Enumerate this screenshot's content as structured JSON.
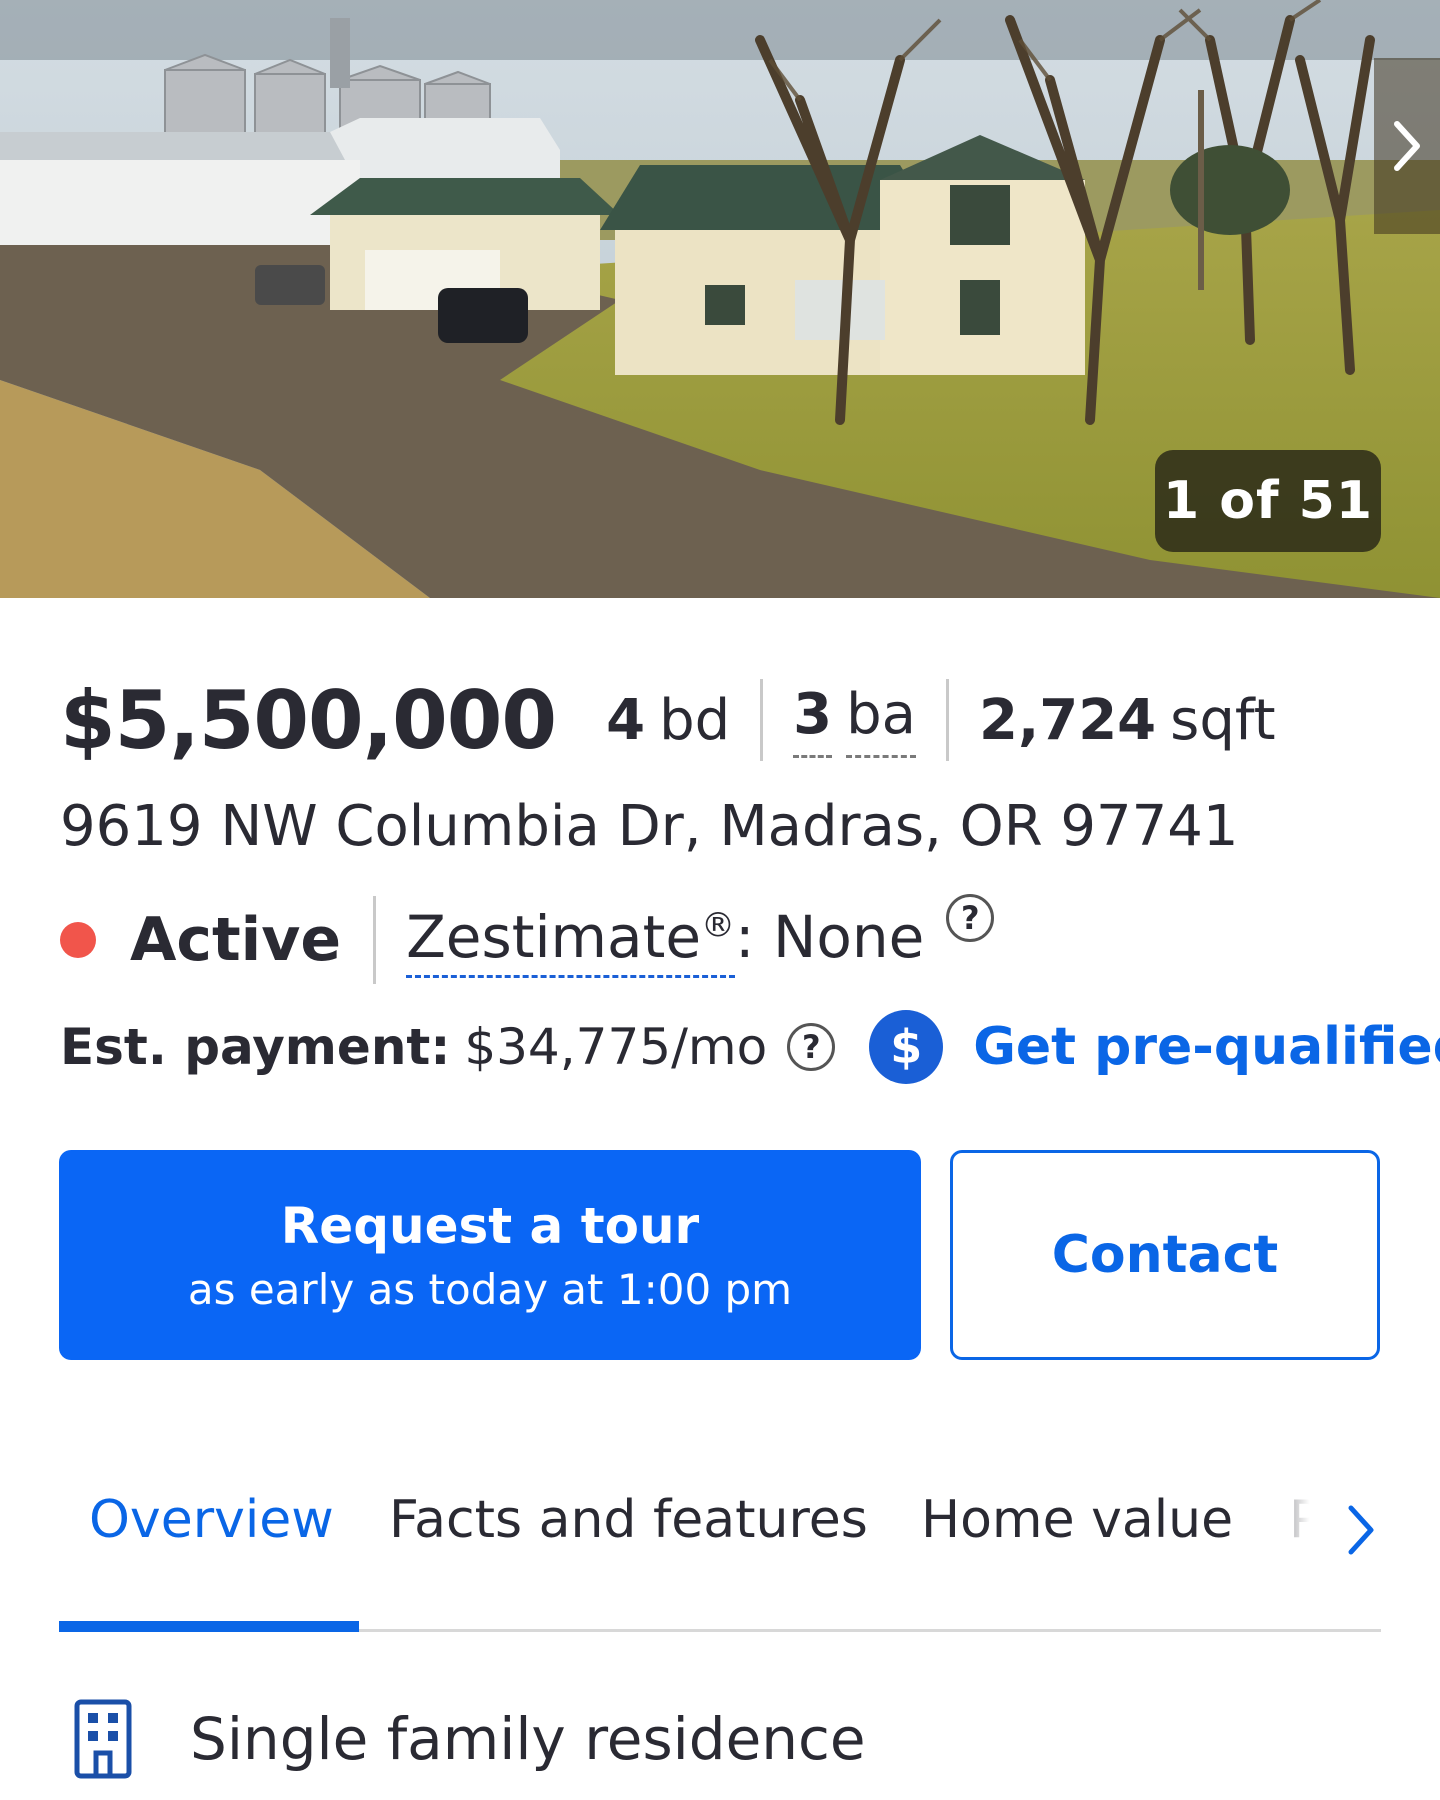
{
  "gallery": {
    "counter": "1 of 51",
    "next_icon": "chevron-right-icon"
  },
  "listing": {
    "price": "$5,500,000",
    "beds_value": "4",
    "beds_unit": "bd",
    "baths_value": "3",
    "baths_unit": "ba",
    "sqft_value": "2,724",
    "sqft_unit": "sqft",
    "address": "9619 NW Columbia Dr, Madras, OR 97741",
    "status": "Active",
    "status_color": "#f1554b",
    "zestimate_label": "Zestimate",
    "zestimate_mark": "®",
    "zestimate_value": ": None",
    "help_glyph": "?"
  },
  "payment": {
    "label": "Est. payment:",
    "value": "$34,775/mo",
    "help_glyph": "?",
    "dollar_glyph": "$",
    "prequal_label": "Get pre-qualified"
  },
  "actions": {
    "tour_label": "Request a tour",
    "tour_sub": "as early as today at 1:00 pm",
    "contact_label": "Contact",
    "accent_color": "#0a66f5"
  },
  "tabs": {
    "items": [
      {
        "label": "Overview",
        "active": true
      },
      {
        "label": "Facts and features",
        "active": false
      },
      {
        "label": "Home value",
        "active": false
      },
      {
        "label": "P",
        "active": false
      }
    ],
    "more_icon": "chevron-right-icon"
  },
  "details": {
    "type_icon": "building-icon",
    "type_label": "Single family residence"
  }
}
